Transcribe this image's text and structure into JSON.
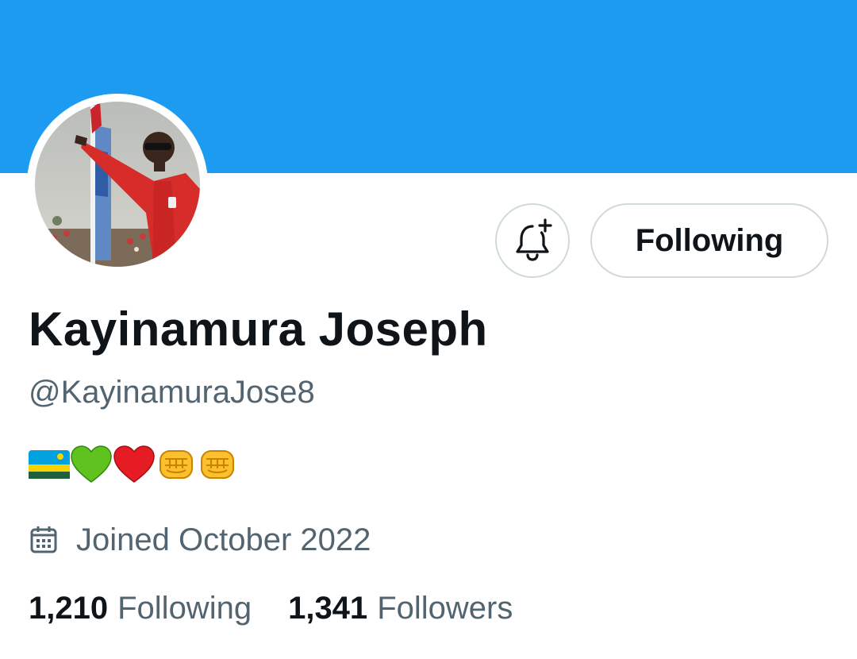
{
  "profile": {
    "name": "Kayinamura Joseph",
    "handle": "@KayinamuraJose8",
    "bio_emojis": [
      "rwanda-flag",
      "green-heart",
      "red-heart",
      "raised-fist",
      "raised-fist"
    ],
    "joined": "Joined October 2022"
  },
  "actions": {
    "follow_label": "Following",
    "notify_icon": "bell-plus-icon"
  },
  "stats": {
    "following_count": "1,210",
    "following_label": "Following",
    "followers_count": "1,341",
    "followers_label": "Followers"
  },
  "colors": {
    "banner": "#1d9bf0",
    "text_primary": "#0f1419",
    "text_secondary": "#536471",
    "border": "#cfd9de"
  }
}
